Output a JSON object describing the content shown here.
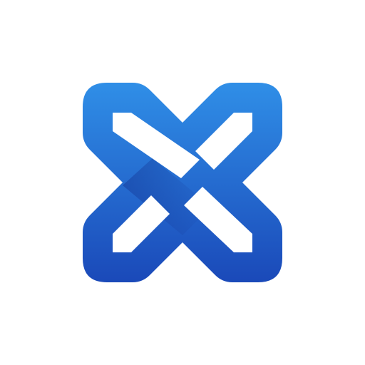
{
  "logo": {
    "name": "interlocking-x-logo",
    "colors": {
      "top": "#3090E8",
      "bottom": "#1A48B8",
      "shadow": "#153C9C",
      "background": "#FFFFFF"
    }
  }
}
